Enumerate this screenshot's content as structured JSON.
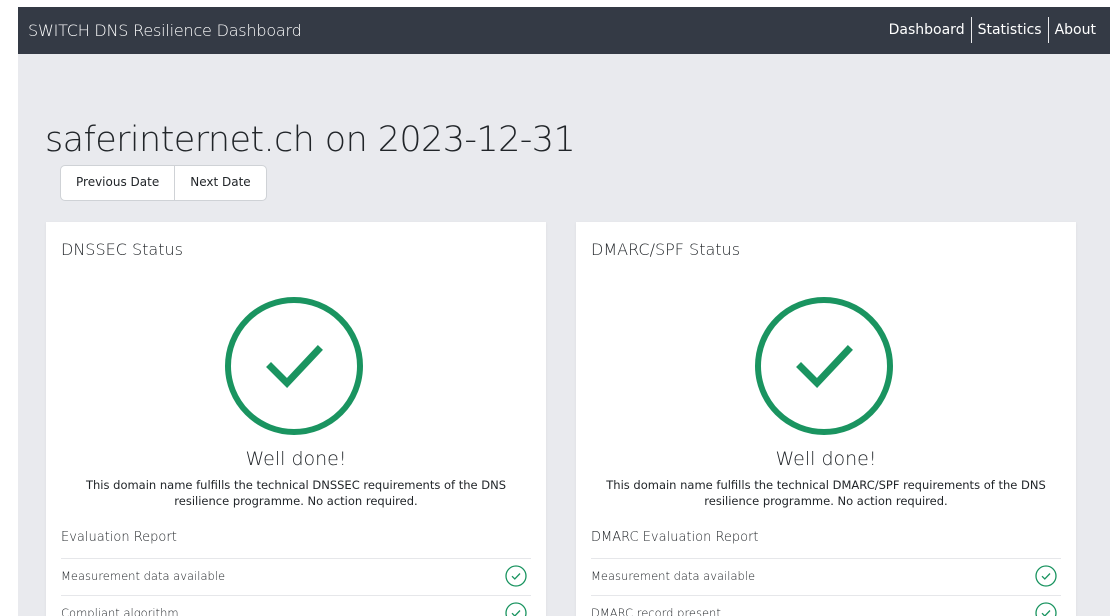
{
  "navbar": {
    "brand": "SWITCH DNS Resilience Dashboard",
    "links": [
      {
        "label": "Dashboard"
      },
      {
        "label": "Statistics"
      },
      {
        "label": "About"
      }
    ]
  },
  "page": {
    "title": "saferinternet.ch on 2023-12-31",
    "previous_date_label": "Previous Date",
    "next_date_label": "Next Date"
  },
  "colors": {
    "navbar_bg": "#343a45",
    "page_bg": "#e9eaee",
    "success": "#1a9460"
  },
  "cards": {
    "dnssec": {
      "title": "DNSSEC Status",
      "status_icon": "check-circle-icon",
      "headline": "Well done!",
      "description": "This domain name fulfills the technical DNSSEC requirements of the DNS resilience programme. No action required.",
      "report_title": "Evaluation Report",
      "items": [
        {
          "label": "Measurement data available",
          "icon": "check-circle-icon"
        },
        {
          "label": "Compliant algorithm",
          "icon": "check-circle-icon"
        }
      ]
    },
    "dmarc": {
      "title": "DMARC/SPF Status",
      "status_icon": "check-circle-icon",
      "headline": "Well done!",
      "description": "This domain name fulfills the technical DMARC/SPF requirements of the DNS resilience programme. No action required.",
      "report_title": "DMARC Evaluation Report",
      "items": [
        {
          "label": "Measurement data available",
          "icon": "check-circle-icon"
        },
        {
          "label": "DMARC record present",
          "icon": "check-circle-icon"
        }
      ]
    }
  }
}
